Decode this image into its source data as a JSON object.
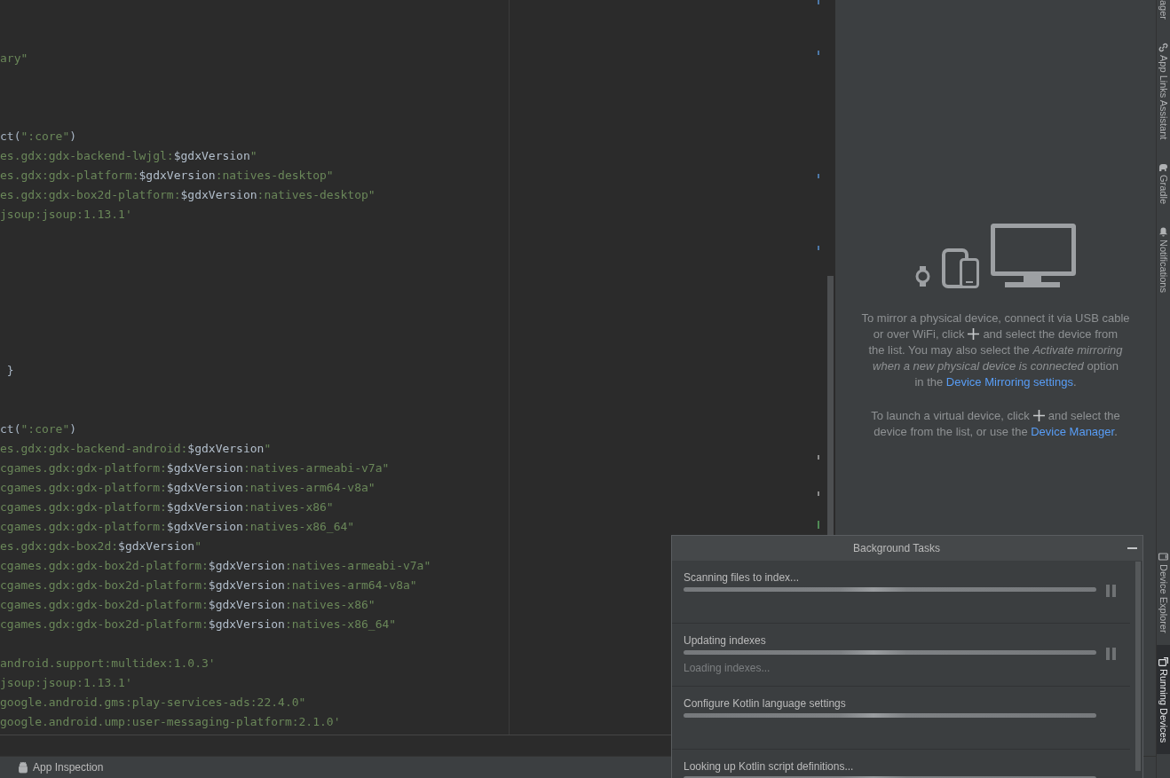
{
  "editor": {
    "code_groups": [
      {
        "lines": [
          {
            "segments": [
              {
                "kind": "string",
                "text": "ary\""
              }
            ]
          }
        ]
      },
      {
        "lines": [
          {
            "segments": [
              {
                "kind": "plain",
                "text": "ct("
              },
              {
                "kind": "string",
                "text": "\":core\""
              },
              {
                "kind": "plain",
                "text": ")"
              }
            ]
          },
          {
            "segments": [
              {
                "kind": "string",
                "text": "es.gdx:gdx-backend-lwjgl:"
              },
              {
                "kind": "variable",
                "text": "$gdxVersion"
              },
              {
                "kind": "string",
                "text": "\""
              }
            ]
          },
          {
            "segments": [
              {
                "kind": "string",
                "text": "es.gdx:gdx-platform:"
              },
              {
                "kind": "variable",
                "text": "$gdxVersion"
              },
              {
                "kind": "string",
                "text": ":natives-desktop\""
              }
            ]
          },
          {
            "segments": [
              {
                "kind": "string",
                "text": "es.gdx:gdx-box2d-platform:"
              },
              {
                "kind": "variable",
                "text": "$gdxVersion"
              },
              {
                "kind": "string",
                "text": ":natives-desktop\""
              }
            ]
          },
          {
            "segments": [
              {
                "kind": "string",
                "text": "jsoup:jsoup:1.13.1'"
              }
            ]
          }
        ]
      },
      {
        "lines": [
          {
            "segments": [
              {
                "kind": "plain",
                "text": " }"
              }
            ]
          }
        ]
      },
      {
        "lines": [
          {
            "segments": [
              {
                "kind": "plain",
                "text": "ct("
              },
              {
                "kind": "string",
                "text": "\":core\""
              },
              {
                "kind": "plain",
                "text": ")"
              }
            ]
          },
          {
            "segments": [
              {
                "kind": "string",
                "text": "es.gdx:gdx-backend-android:"
              },
              {
                "kind": "variable",
                "text": "$gdxVersion"
              },
              {
                "kind": "string",
                "text": "\""
              }
            ]
          },
          {
            "segments": [
              {
                "kind": "string",
                "text": "cgames.gdx:gdx-platform:"
              },
              {
                "kind": "variable",
                "text": "$gdxVersion"
              },
              {
                "kind": "string",
                "text": ":natives-armeabi-v7a\""
              }
            ]
          },
          {
            "segments": [
              {
                "kind": "string",
                "text": "cgames.gdx:gdx-platform:"
              },
              {
                "kind": "variable",
                "text": "$gdxVersion"
              },
              {
                "kind": "string",
                "text": ":natives-arm64-v8a\""
              }
            ]
          },
          {
            "segments": [
              {
                "kind": "string",
                "text": "cgames.gdx:gdx-platform:"
              },
              {
                "kind": "variable",
                "text": "$gdxVersion"
              },
              {
                "kind": "string",
                "text": ":natives-x86\""
              }
            ]
          },
          {
            "segments": [
              {
                "kind": "string",
                "text": "cgames.gdx:gdx-platform:"
              },
              {
                "kind": "variable",
                "text": "$gdxVersion"
              },
              {
                "kind": "string",
                "text": ":natives-x86_64\""
              }
            ]
          },
          {
            "segments": [
              {
                "kind": "string",
                "text": "es.gdx:gdx-box2d:"
              },
              {
                "kind": "variable",
                "text": "$gdxVersion"
              },
              {
                "kind": "string",
                "text": "\""
              }
            ]
          },
          {
            "segments": [
              {
                "kind": "string",
                "text": "cgames.gdx:gdx-box2d-platform:"
              },
              {
                "kind": "variable",
                "text": "$gdxVersion"
              },
              {
                "kind": "string",
                "text": ":natives-armeabi-v7a\""
              }
            ]
          },
          {
            "segments": [
              {
                "kind": "string",
                "text": "cgames.gdx:gdx-box2d-platform:"
              },
              {
                "kind": "variable",
                "text": "$gdxVersion"
              },
              {
                "kind": "string",
                "text": ":natives-arm64-v8a\""
              }
            ]
          },
          {
            "segments": [
              {
                "kind": "string",
                "text": "cgames.gdx:gdx-box2d-platform:"
              },
              {
                "kind": "variable",
                "text": "$gdxVersion"
              },
              {
                "kind": "string",
                "text": ":natives-x86\""
              }
            ]
          },
          {
            "segments": [
              {
                "kind": "string",
                "text": "cgames.gdx:gdx-box2d-platform:"
              },
              {
                "kind": "variable",
                "text": "$gdxVersion"
              },
              {
                "kind": "string",
                "text": ":natives-x86_64\""
              }
            ]
          }
        ]
      },
      {
        "lines": [
          {
            "segments": [
              {
                "kind": "string",
                "text": "android.support:multidex:1.0.3'"
              }
            ]
          },
          {
            "segments": [
              {
                "kind": "string",
                "text": "jsoup:jsoup:1.13.1'"
              }
            ]
          },
          {
            "segments": [
              {
                "kind": "string",
                "text": "google.android.gms:play-services-ads:22.4.0\""
              }
            ]
          },
          {
            "segments": [
              {
                "kind": "string",
                "text": "google.android.ump:user-messaging-platform:2.1.0'"
              }
            ]
          }
        ]
      }
    ],
    "stripe_marks": [
      {
        "color": "#4d78a8"
      },
      {
        "color": "#4d78a8"
      },
      {
        "color": "#4d78a8"
      },
      {
        "color": "#4d78a8"
      },
      {
        "color": "#8c8c8c"
      },
      {
        "color": "#8c8c8c"
      },
      {
        "color": "#4f8a55"
      }
    ]
  },
  "running_devices": {
    "mirror_hint": {
      "lines": [
        [
          {
            "kind": "text",
            "text": "To mirror a physical device, connect it via USB cable"
          }
        ],
        [
          {
            "kind": "text",
            "text": "or over WiFi, click"
          },
          {
            "kind": "plus"
          },
          {
            "kind": "text",
            "text": "and select the device from"
          }
        ],
        [
          {
            "kind": "text",
            "text": "the list. You may also select the *Activate mirroring*"
          }
        ],
        [
          {
            "kind": "text",
            "text": "*when a new physical device is connected* option"
          }
        ],
        [
          {
            "kind": "text",
            "text": "in the"
          },
          {
            "kind": "link",
            "text": "Device Mirroring settings"
          },
          {
            "kind": "text",
            "text": "."
          }
        ]
      ]
    },
    "virtual_hint": {
      "lines": [
        [
          {
            "kind": "text",
            "text": "To launch a virtual device, click"
          },
          {
            "kind": "plus"
          },
          {
            "kind": "text",
            "text": "and select the"
          }
        ],
        [
          {
            "kind": "text",
            "text": "device from the list, or use the"
          },
          {
            "kind": "link",
            "text": "Device Manager"
          },
          {
            "kind": "text",
            "text": "."
          }
        ]
      ]
    }
  },
  "right_toolbar": {
    "top": [
      {
        "label": "ager",
        "selected": false
      },
      {
        "label": "App Links Assistant",
        "selected": false
      },
      {
        "label": "Gradle",
        "selected": false
      },
      {
        "label": "Notifications",
        "selected": false
      }
    ],
    "bottom": [
      {
        "label": "Device Explorer",
        "selected": false
      },
      {
        "label": "Running Devices",
        "selected": true
      }
    ]
  },
  "bottom_toolbar": {
    "items": [
      {
        "label": "App Inspection"
      }
    ]
  },
  "background_tasks": {
    "title": "Background Tasks",
    "tasks": [
      {
        "title": "Scanning files to index...",
        "pausable": true
      },
      {
        "title": "Updating indexes",
        "detail": "Loading indexes...",
        "pausable": true
      },
      {
        "title": "Configure Kotlin language settings",
        "pausable": false
      },
      {
        "title": "Looking up Kotlin script definitions...",
        "pausable": false
      }
    ]
  }
}
